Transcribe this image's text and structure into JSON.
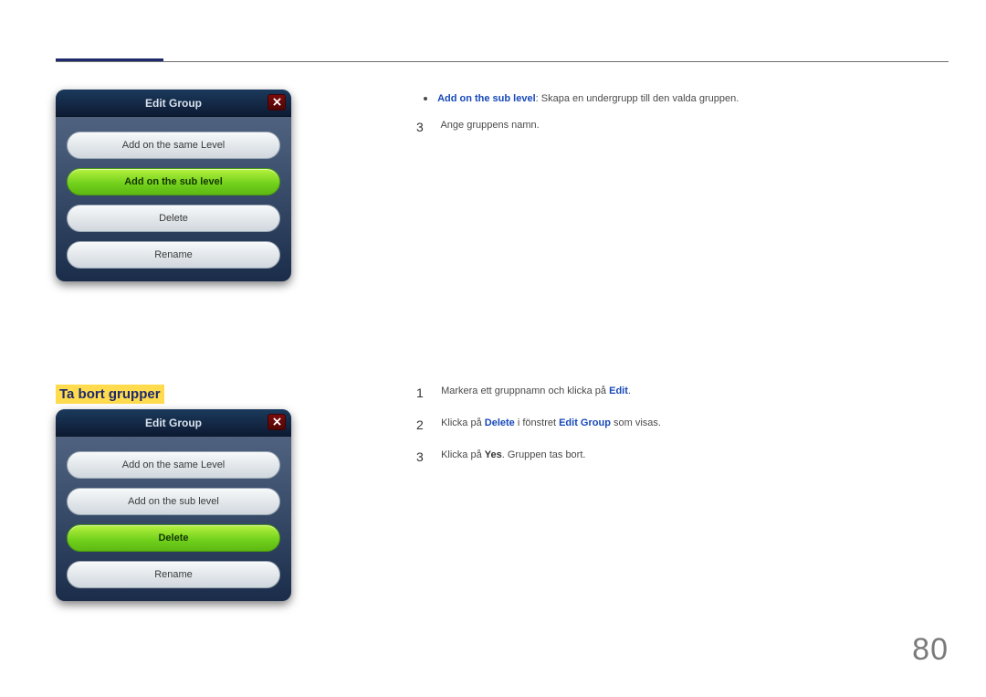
{
  "page_number": "80",
  "top_section": {
    "dialog_title": "Edit Group",
    "options": {
      "o1": "Add on the same Level",
      "o2": "Add on the sub level",
      "o3": "Delete",
      "o4": "Rename"
    },
    "bullet": {
      "label": "Add on the sub level",
      "rest": ": Skapa en undergrupp till den valda gruppen."
    },
    "step3": {
      "num": "3",
      "text": "Ange gruppens namn."
    }
  },
  "bottom_section": {
    "heading": "Ta bort grupper",
    "dialog_title": "Edit Group",
    "options": {
      "o1": "Add on the same Level",
      "o2": "Add on the sub level",
      "o3": "Delete",
      "o4": "Rename"
    },
    "steps": {
      "s1": {
        "num": "1",
        "pre": "Markera ett gruppnamn och klicka på ",
        "link": "Edit",
        "post": "."
      },
      "s2": {
        "num": "2",
        "pre": "Klicka på ",
        "link1": "Delete",
        "mid": " i fönstret ",
        "link2": "Edit Group",
        "post": " som visas."
      },
      "s3": {
        "num": "3",
        "pre": "Klicka på ",
        "bold": "Yes",
        "post": ". Gruppen tas bort."
      }
    }
  }
}
